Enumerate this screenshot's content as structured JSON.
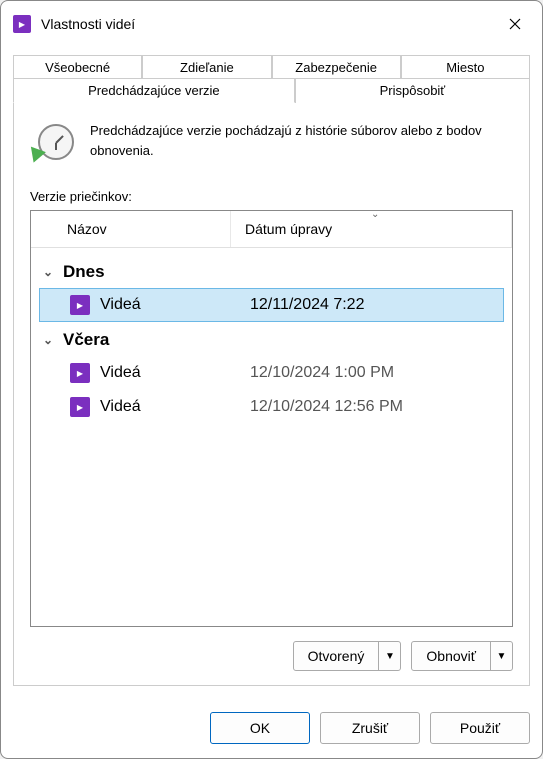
{
  "window": {
    "title": "Vlastnosti videí"
  },
  "tabs": {
    "row1": [
      "Všeobecné",
      "Zdieľanie",
      "Zabezpečenie",
      "Miesto"
    ],
    "row2": [
      "Predchádzajúce verzie",
      "Prispôsobiť"
    ],
    "active": "Predchádzajúce verzie"
  },
  "info": {
    "text": "Predchádzajúce verzie pochádzajú z histórie súborov alebo z bodov obnovenia."
  },
  "versions": {
    "label": "Verzie priečinkov:",
    "columns": {
      "name": "Názov",
      "date": "Dátum úpravy"
    },
    "groups": [
      {
        "label": "Dnes",
        "items": [
          {
            "name": "Videá",
            "date": "12/11/2024 7:22",
            "selected": true
          }
        ]
      },
      {
        "label": "Včera",
        "items": [
          {
            "name": "Videá",
            "date": "12/10/2024 1:00 PM",
            "selected": false
          },
          {
            "name": "Videá",
            "date": "12/10/2024 12:56 PM",
            "selected": false
          }
        ]
      }
    ]
  },
  "actions": {
    "open": "Otvorený",
    "restore": "Obnoviť"
  },
  "dialog": {
    "ok": "OK",
    "cancel": "Zrušiť",
    "apply": "Použiť"
  }
}
